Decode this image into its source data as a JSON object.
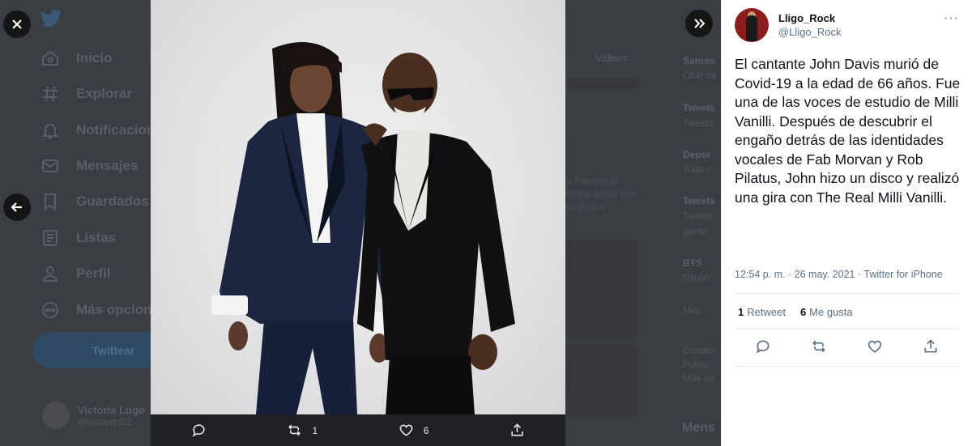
{
  "background": {
    "nav": [
      {
        "label": "Inicio",
        "icon": "home-icon"
      },
      {
        "label": "Explorar",
        "icon": "hashtag-icon"
      },
      {
        "label": "Notificacion",
        "icon": "bell-icon"
      },
      {
        "label": "Mensajes",
        "icon": "mail-icon"
      },
      {
        "label": "Guardados",
        "icon": "bookmark-icon"
      },
      {
        "label": "Listas",
        "icon": "list-icon"
      },
      {
        "label": "Perfil",
        "icon": "person-icon"
      },
      {
        "label": "Más opcion",
        "icon": "more-icon"
      }
    ],
    "tweet_button": "Twittear",
    "profile_name": "Victoria Lugo",
    "profile_handle": "@vicuugo22",
    "videos_tab": "Videos",
    "snippet": "s. Fue una de ngaño detrás hizo un disco y",
    "trends": [
      "Santos",
      "Club de",
      "Tweets",
      "Tweets",
      "Depor",
      "Todo s",
      "Tweets",
      "Tweets",
      "gente",
      "BTS",
      "Grupo",
      "Mos",
      "Condici",
      "Polític",
      "Más op"
    ],
    "messages_label": "Mens"
  },
  "photo": {
    "alt": "Dos hombres posando con trajes oscuros sobre fondo gris"
  },
  "action_bar": {
    "retweets": "1",
    "likes": "6"
  },
  "tweet": {
    "author_name": "Lligo_Rock",
    "author_handle": "@Lligo_Rock",
    "more": "···",
    "text": "El cantante John Davis murió de Covid-19 a la edad de 66 años. Fue una de las voces de estudio de Milli Vanilli. Después de descubrir el engaño detrás de las identidades vocales de Fab Morvan y Rob Pilatus, John hizo un disco y realizó una gira con The Real Milli Vanilli.",
    "time": "12:54 p. m.",
    "date": "26 may. 2021",
    "client": "Twitter for iPhone",
    "retweet_count": "1",
    "retweet_label": "Retweet",
    "like_count": "6",
    "like_label": "Me gusta"
  },
  "colors": {
    "accent": "#1da1f2",
    "panel_bg": "#ffffff",
    "overlay": "#2b2d31"
  }
}
